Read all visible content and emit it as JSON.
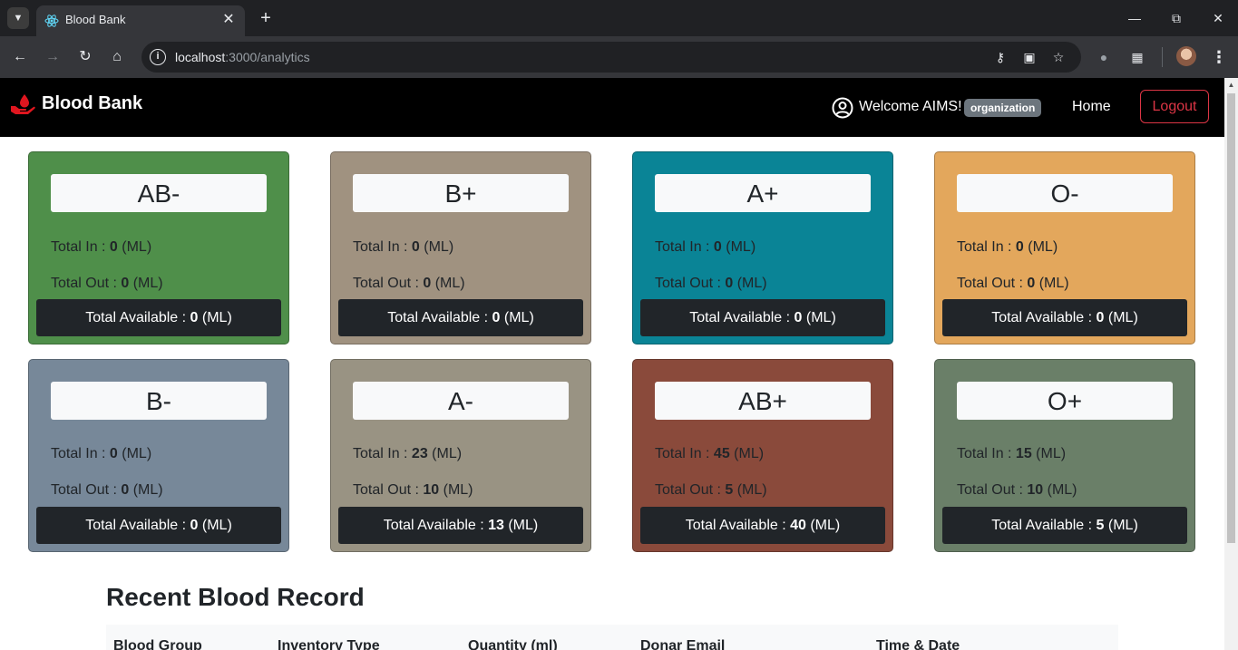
{
  "browser": {
    "tab_title": "Blood Bank",
    "url_host": "localhost",
    "url_rest": ":3000/analytics"
  },
  "nav": {
    "brand": "Blood Bank",
    "welcome": "Welcome AIMS!",
    "role": "organization",
    "home": "Home",
    "logout": "Logout"
  },
  "labels": {
    "total_in": "Total In : ",
    "total_out": "Total Out : ",
    "total_available": "Total Available : ",
    "unit": " (ML)"
  },
  "cards": [
    {
      "group": "AB-",
      "in": "0",
      "out": "0",
      "available": "0",
      "color": "#4f8f4a"
    },
    {
      "group": "B+",
      "in": "0",
      "out": "0",
      "available": "0",
      "color": "#a09280"
    },
    {
      "group": "A+",
      "in": "0",
      "out": "0",
      "available": "0",
      "color": "#0a8496"
    },
    {
      "group": "O-",
      "in": "0",
      "out": "0",
      "available": "0",
      "color": "#e3a75c"
    },
    {
      "group": "B-",
      "in": "0",
      "out": "0",
      "available": "0",
      "color": "#778899"
    },
    {
      "group": "A-",
      "in": "23",
      "out": "10",
      "available": "13",
      "color": "#999383"
    },
    {
      "group": "AB+",
      "in": "45",
      "out": "5",
      "available": "40",
      "color": "#8a4a3b"
    },
    {
      "group": "O+",
      "in": "15",
      "out": "10",
      "available": "5",
      "color": "#6a7f68"
    }
  ],
  "recent": {
    "title": "Recent Blood Record",
    "columns": [
      "Blood Group",
      "Inventory Type",
      "Quantity (ml)",
      "Donar Email",
      "Time & Date"
    ]
  }
}
